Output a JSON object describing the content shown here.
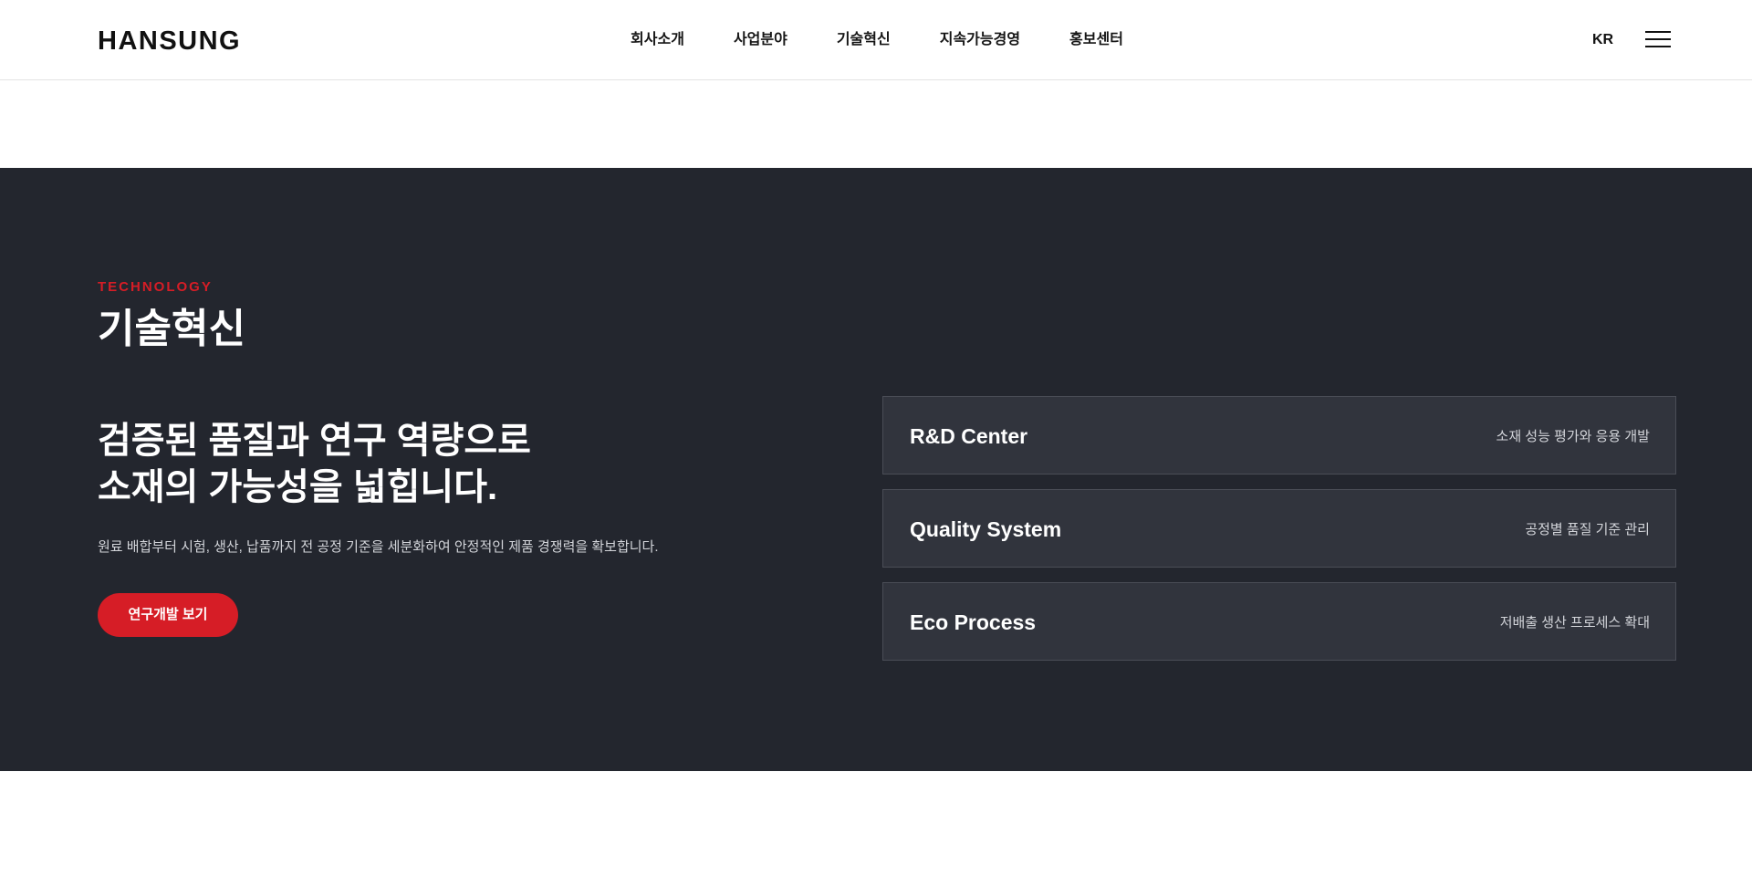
{
  "header": {
    "logo": "HANSUNG",
    "nav": [
      {
        "label": "회사소개"
      },
      {
        "label": "사업분야"
      },
      {
        "label": "기술혁신"
      },
      {
        "label": "지속가능경영"
      },
      {
        "label": "홍보센터"
      }
    ],
    "lang": "KR",
    "menu_icon": "hamburger-menu-icon"
  },
  "tech": {
    "eyebrow": "TECHNOLOGY",
    "title": "기술혁신",
    "headline_line1": "검증된 품질과 연구 역량으로",
    "headline_line2": "소재의 가능성을 넓힙니다.",
    "description": "원료 배합부터 시험, 생산, 납품까지 전 공정 기준을 세분화하여 안정적인 제품 경쟁력을 확보합니다.",
    "cta_label": "연구개발 보기",
    "cards": [
      {
        "title": "R&D Center",
        "desc": "소재 성능 평가와 응용 개발"
      },
      {
        "title": "Quality System",
        "desc": "공정별 품질 기준 관리"
      },
      {
        "title": "Eco Process",
        "desc": "저배출 생산 프로세스 확대"
      }
    ]
  },
  "colors": {
    "accent": "#d61d26",
    "section_bg": "#23262e",
    "card_bg": "#31343d",
    "card_border": "#4a4d56"
  }
}
